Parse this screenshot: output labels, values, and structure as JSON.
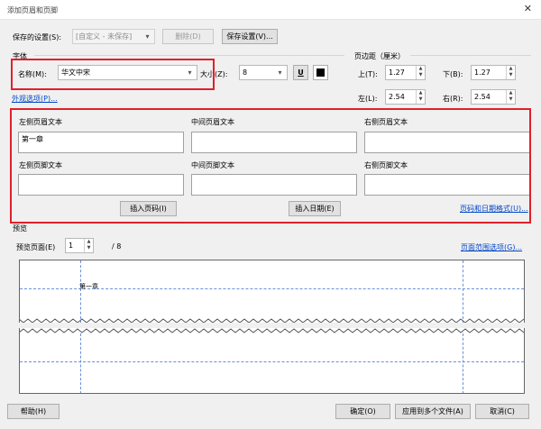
{
  "window": {
    "title": "添加页眉和页脚",
    "close_glyph": "✕"
  },
  "saved": {
    "label": "保存的设置(S):",
    "value": "[自定义 - 未保存]",
    "delete_label": "删除(D)",
    "save_label": "保存设置(V)..."
  },
  "font": {
    "group_label": "字体",
    "name_label": "名称(M):",
    "name_value": "华文中宋",
    "size_label": "大小(Z):",
    "size_value": "8",
    "underline_glyph": "U",
    "appearance_link": "外观选项(P)..."
  },
  "margins": {
    "group_label": "页边距（厘米）",
    "top_label": "上(T):",
    "top_value": "1.27",
    "bottom_label": "下(B):",
    "bottom_value": "1.27",
    "left_label": "左(L):",
    "left_value": "2.54",
    "right_label": "右(R):",
    "right_value": "2.54"
  },
  "fields": {
    "left_header_label": "左侧页眉文本",
    "left_header_value": "第一章",
    "center_header_label": "中间页眉文本",
    "right_header_label": "右侧页眉文本",
    "left_footer_label": "左侧页脚文本",
    "center_footer_label": "中间页脚文本",
    "right_footer_label": "右侧页脚文本",
    "insert_page_label": "插入页码(I)",
    "insert_date_label": "插入日期(E)",
    "page_date_format_link": "页码和日期格式(U)..."
  },
  "preview": {
    "group_label": "预览",
    "page_label": "预览页面(E)",
    "page_value": "1",
    "page_total": "/ 8",
    "range_link": "页面范围选项(G)...",
    "header_text": "第一章"
  },
  "footer_buttons": {
    "help": "帮助(H)",
    "ok": "确定(O)",
    "apply_multi": "应用到多个文件(A)",
    "cancel": "取消(C)"
  }
}
